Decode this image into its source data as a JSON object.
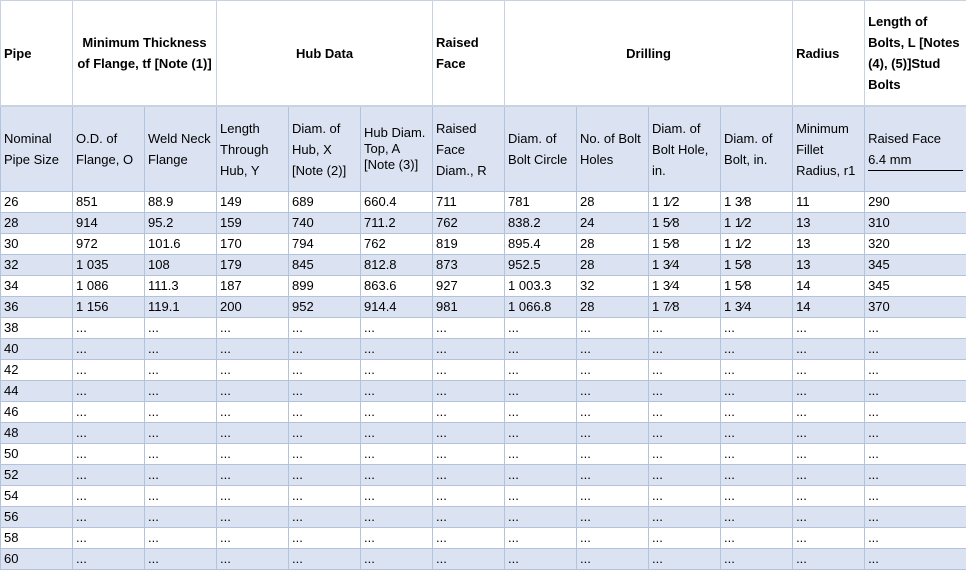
{
  "header": {
    "pipe": "Pipe",
    "thickness": "Minimum Thickness of Flange, tf [Note (1)]",
    "hub_data": "Hub Data",
    "raised_face": "Raised Face",
    "drilling": "Drilling",
    "radius": "Radius",
    "bolt_length": "Length of Bolts, L [Notes (4), (5)]Stud Bolts"
  },
  "subheader": {
    "nominal_pipe_size": "Nominal Pipe Size",
    "od_flange": "O.D. of Flange, O",
    "weld_neck": "Weld Neck Flange",
    "length_through_hub": "Length Through Hub,  Y",
    "diam_hub": "Diam. of Hub, X [Note  (2)]",
    "hub_diam_top": "Hub Diam. Top, A [Note  (3)]",
    "raised_face_diam": "Raised Face Diam., R",
    "bolt_circle": "Diam. of Bolt Circle",
    "no_bolt_holes": "No. of Bolt Holes",
    "diam_bolt_hole": "Diam. of Bolt Hole, in.",
    "diam_bolt": "Diam. of Bolt, in.",
    "fillet_radius": "Minimum Fillet Radius, r1",
    "raised_face_mm": "Raised Face 6.4 mm"
  },
  "rows": [
    [
      "26",
      "851",
      "88.9",
      "149",
      "689",
      "660.4",
      "711",
      "781",
      "28",
      "1 1⁄2",
      "1 3⁄8",
      "11",
      "290"
    ],
    [
      "28",
      "914",
      "95.2",
      "159",
      "740",
      "711.2",
      "762",
      "838.2",
      "24",
      "1 5⁄8",
      "1 1⁄2",
      "13",
      "310"
    ],
    [
      "30",
      "972",
      "101.6",
      "170",
      "794",
      "762",
      "819",
      "895.4",
      "28",
      "1 5⁄8",
      "1 1⁄2",
      "13",
      "320"
    ],
    [
      "32",
      "1 035",
      "108",
      "179",
      "845",
      "812.8",
      "873",
      "952.5",
      "28",
      "1 3⁄4",
      "1 5⁄8",
      "13",
      "345"
    ],
    [
      "34",
      "1 086",
      "111.3",
      "187",
      "899",
      "863.6",
      "927",
      "1 003.3",
      "32",
      "1 3⁄4",
      "1 5⁄8",
      "14",
      "345"
    ],
    [
      "36",
      "1 156",
      "119.1",
      "200",
      "952",
      "914.4",
      "981",
      "1 066.8",
      "28",
      "1 7⁄8",
      "1 3⁄4",
      "14",
      "370"
    ],
    [
      "38",
      "...",
      "...",
      "...",
      "...",
      "...",
      "...",
      "...",
      "...",
      "...",
      "...",
      "...",
      "..."
    ],
    [
      "40",
      "...",
      "...",
      "...",
      "...",
      "...",
      "...",
      "...",
      "...",
      "...",
      "...",
      "...",
      "..."
    ],
    [
      "42",
      "...",
      "...",
      "...",
      "...",
      "...",
      "...",
      "...",
      "...",
      "...",
      "...",
      "...",
      "..."
    ],
    [
      "44",
      "...",
      "...",
      "...",
      "...",
      "...",
      "...",
      "...",
      "...",
      "...",
      "...",
      "...",
      "..."
    ],
    [
      "46",
      "...",
      "...",
      "...",
      "...",
      "...",
      "...",
      "...",
      "...",
      "...",
      "...",
      "...",
      "..."
    ],
    [
      "48",
      "...",
      "...",
      "...",
      "...",
      "...",
      "...",
      "...",
      "...",
      "...",
      "...",
      "...",
      "..."
    ],
    [
      "50",
      "...",
      "...",
      "...",
      "...",
      "...",
      "...",
      "...",
      "...",
      "...",
      "...",
      "...",
      "..."
    ],
    [
      "52",
      "...",
      "...",
      "...",
      "...",
      "...",
      "...",
      "...",
      "...",
      "...",
      "...",
      "...",
      "..."
    ],
    [
      "54",
      "...",
      "...",
      "...",
      "...",
      "...",
      "...",
      "...",
      "...",
      "...",
      "...",
      "...",
      "..."
    ],
    [
      "56",
      "...",
      "...",
      "...",
      "...",
      "...",
      "...",
      "...",
      "...",
      "...",
      "...",
      "...",
      "..."
    ],
    [
      "58",
      "...",
      "...",
      "...",
      "...",
      "...",
      "...",
      "...",
      "...",
      "...",
      "...",
      "...",
      "..."
    ],
    [
      "60",
      "...",
      "...",
      "...",
      "...",
      "...",
      "...",
      "...",
      "...",
      "...",
      "...",
      "...",
      "..."
    ]
  ]
}
